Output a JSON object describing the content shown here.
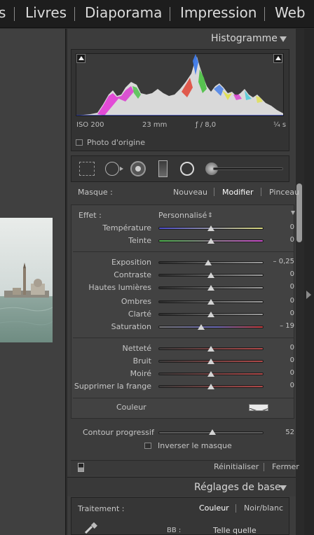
{
  "modules": [
    "s",
    "Livres",
    "Diaporama",
    "Impression",
    "Web"
  ],
  "histogram": {
    "title": "Histogramme",
    "iso": "ISO 200",
    "focal": "23 mm",
    "aperture": "ƒ / 8,0",
    "shutter": "¼ s",
    "original_label": "Photo d'origine"
  },
  "mask": {
    "label": "Masque :",
    "nouveau": "Nouveau",
    "modifier": "Modifier",
    "pinceau": "Pinceau"
  },
  "effect": {
    "label": "Effet :",
    "preset": "Personnalisé",
    "sliders": [
      {
        "label": "Température",
        "value": "0",
        "pos": 0
      },
      {
        "label": "Teinte",
        "value": "0",
        "pos": 0
      },
      {
        "label": "Exposition",
        "value": "– 0,25",
        "pos": -0.06
      },
      {
        "label": "Contraste",
        "value": "0",
        "pos": 0
      },
      {
        "label": "Hautes lumières",
        "value": "0",
        "pos": 0
      },
      {
        "label": "Ombres",
        "value": "0",
        "pos": 0
      },
      {
        "label": "Clarté",
        "value": "0",
        "pos": 0
      },
      {
        "label": "Saturation",
        "value": "– 19",
        "pos": -0.19
      },
      {
        "label": "Netteté",
        "value": "0",
        "pos": 0
      },
      {
        "label": "Bruit",
        "value": "0",
        "pos": 0
      },
      {
        "label": "Moiré",
        "value": "0",
        "pos": 0
      },
      {
        "label": "Supprimer la frange",
        "value": "0",
        "pos": 0
      }
    ],
    "color_label": "Couleur"
  },
  "contour": {
    "label": "Contour progressif",
    "value": "52",
    "invert_label": "Inverser le masque"
  },
  "actions": {
    "reset": "Réinitialiser",
    "close": "Fermer"
  },
  "basic": {
    "title": "Réglages de base",
    "traitement": "Traitement :",
    "couleur": "Couleur",
    "noirblanc": "Noir/blanc",
    "bb": "BB :",
    "bb_value": "Telle quelle"
  },
  "colors": {
    "panel_bg": "#3c3c3c",
    "accent_text": "#ffffff"
  }
}
